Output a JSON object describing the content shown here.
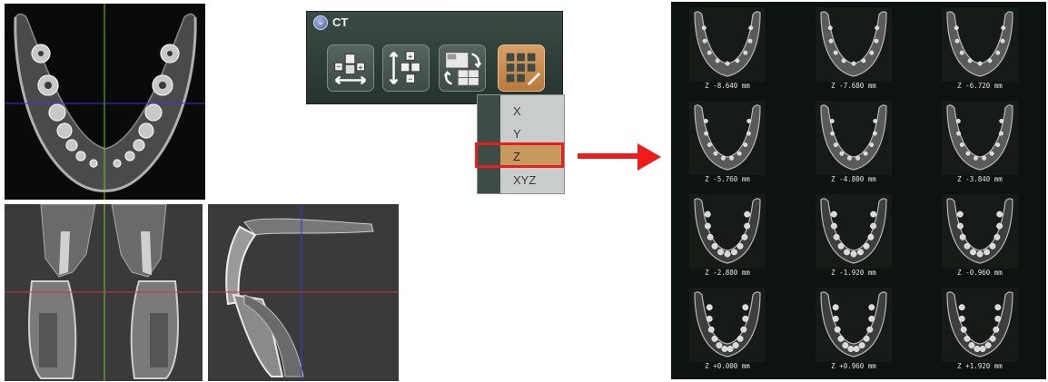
{
  "panel": {
    "title": "CT",
    "collapse_icon": "chevron-down-icon",
    "tools": [
      {
        "name": "horizontal-spacing-tool",
        "icon": "horizontal-spacing-icon",
        "active": false
      },
      {
        "name": "vertical-spacing-tool",
        "icon": "vertical-spacing-icon",
        "active": false
      },
      {
        "name": "rotate-layout-tool",
        "icon": "rotate-layout-icon",
        "active": false
      },
      {
        "name": "grid-layout-tool",
        "icon": "grid-layout-icon",
        "active": true
      }
    ]
  },
  "dropdown": {
    "items": [
      "X",
      "Y",
      "Z",
      "XYZ"
    ],
    "selected": "Z"
  },
  "colors": {
    "highlight": "#ee1c1c",
    "menu_selected": "#c69a5e",
    "crosshair_green": "#7ec03a",
    "crosshair_blue": "#3a3acc",
    "crosshair_red": "#c83a3a"
  },
  "slices": {
    "labels": [
      "Z -8.640 mm",
      "Z -7.680 mm",
      "Z -6.720 mm",
      "Z -5.760 mm",
      "Z -4.800 mm",
      "Z -3.840 mm",
      "Z -2.880 mm",
      "Z -1.920 mm",
      "Z -0.960 mm",
      "Z +0.000 mm",
      "Z +0.960 mm",
      "Z +1.920 mm"
    ]
  }
}
